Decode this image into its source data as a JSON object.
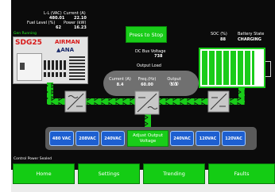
{
  "generator": {
    "labels": {
      "ll": "L-L (VAC)",
      "current": "Current (A)",
      "fuel": "Fuel Level (%)",
      "power": "Power (kW)"
    },
    "values": {
      "ll": "480.01",
      "current": "22.10",
      "fuel": "62",
      "power": "16.23"
    },
    "status": "Gen Running",
    "brand": {
      "model": "SDG25",
      "airman": "AIRMAN",
      "ana": "ANA"
    }
  },
  "controls": {
    "press_to_stop": "Press to Stop"
  },
  "dc_bus": {
    "label": "DC Bus Voltage",
    "value": "738"
  },
  "output_load": {
    "title": "Output Load",
    "headers": [
      "Current (A)",
      "Freq.(Hz)",
      "Output (kW)"
    ],
    "values": [
      "8.4",
      "60.00",
      "5.3"
    ]
  },
  "battery": {
    "soc_label": "SOC (%)",
    "soc_value": "88",
    "state_label": "Battery State",
    "state_value": "CHARGING"
  },
  "voltage_options": [
    "480 VAC",
    "208VAC",
    "240VAC",
    "Adjust Output Voltage",
    "240VAC",
    "120VAC",
    "120VAC"
  ],
  "control_power": "Control Power Sealed",
  "nav": [
    "Home",
    "Settings",
    "Trending",
    "Faults"
  ],
  "colors": {
    "accent": "#19cc19",
    "panel": "#0b0b0b",
    "voltage_button": "#1d5fd0"
  }
}
